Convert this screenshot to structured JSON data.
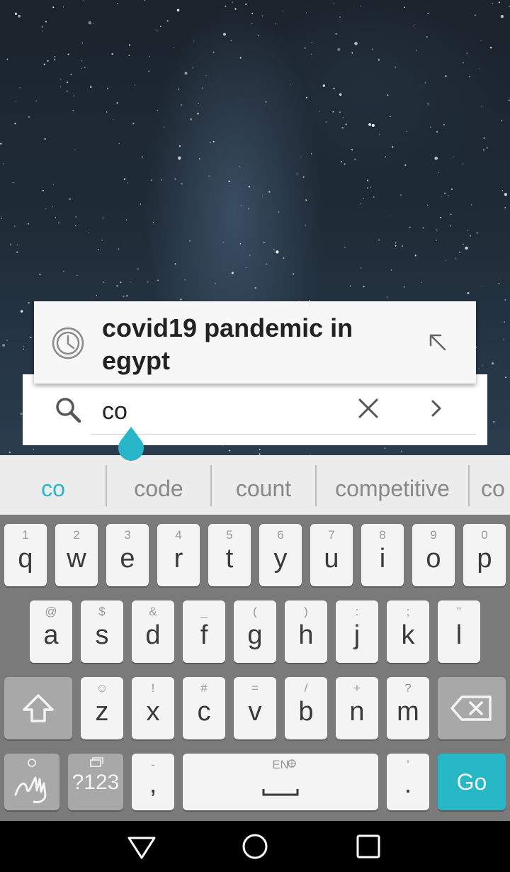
{
  "suggestion": {
    "text": "covid19 pandemic in egypt",
    "icon": "history-clock-icon",
    "fill_icon": "arrow-up-left-icon"
  },
  "search": {
    "value": "co",
    "search_icon": "search-icon",
    "clear_icon": "close-icon",
    "submit_icon": "chevron-right-icon"
  },
  "strip": {
    "words": [
      "co",
      "code",
      "count",
      "competitive",
      "co"
    ]
  },
  "keyboard": {
    "row1": [
      {
        "hint": "1",
        "key": "q"
      },
      {
        "hint": "2",
        "key": "w"
      },
      {
        "hint": "3",
        "key": "e"
      },
      {
        "hint": "4",
        "key": "r"
      },
      {
        "hint": "5",
        "key": "t"
      },
      {
        "hint": "6",
        "key": "y"
      },
      {
        "hint": "7",
        "key": "u"
      },
      {
        "hint": "8",
        "key": "i"
      },
      {
        "hint": "9",
        "key": "o"
      },
      {
        "hint": "0",
        "key": "p"
      }
    ],
    "row2": [
      {
        "hint": "@",
        "key": "a"
      },
      {
        "hint": "$",
        "key": "s"
      },
      {
        "hint": "&",
        "key": "d"
      },
      {
        "hint": "_",
        "key": "f"
      },
      {
        "hint": "(",
        "key": "g"
      },
      {
        "hint": ")",
        "key": "h"
      },
      {
        "hint": ":",
        "key": "j"
      },
      {
        "hint": ";",
        "key": "k"
      },
      {
        "hint": "\"",
        "key": "l"
      }
    ],
    "row3": [
      {
        "hint": "☺",
        "key": "z"
      },
      {
        "hint": "!",
        "key": "x"
      },
      {
        "hint": "#",
        "key": "c"
      },
      {
        "hint": "=",
        "key": "v"
      },
      {
        "hint": "/",
        "key": "b"
      },
      {
        "hint": "+",
        "key": "n"
      },
      {
        "hint": "?",
        "key": "m"
      }
    ],
    "symbols_label": "?123",
    "comma_hint": "-",
    "comma_key": ",",
    "space_hint": "EN",
    "period_hint": "'",
    "period_key": ".",
    "go_label": "Go"
  },
  "colors": {
    "accent": "#29b6c9",
    "go_key": "#27b8c8",
    "keyboard_bg": "#7a7a7a"
  }
}
